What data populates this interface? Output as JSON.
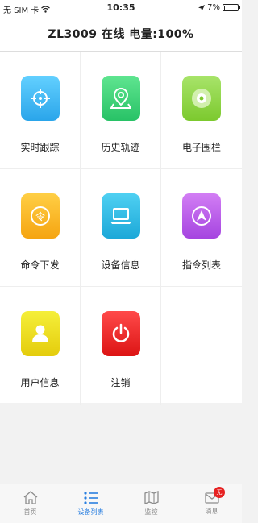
{
  "status_bar": {
    "carrier": "无 SIM 卡",
    "time": "10:35",
    "battery_percent": "7%",
    "battery_level": 0.07
  },
  "nav": {
    "title": "ZL3009   在线   电量:100%"
  },
  "menu": [
    {
      "label": "实时跟踪",
      "icon": "crosshair-icon",
      "color_top": "#63d0ff",
      "color_bottom": "#2aa5ea"
    },
    {
      "label": "历史轨迹",
      "icon": "map-pin-icon",
      "color_top": "#5fe590",
      "color_bottom": "#28c266"
    },
    {
      "label": "电子围栏",
      "icon": "fence-icon",
      "color_top": "#a8e46a",
      "color_bottom": "#7cc92e"
    },
    {
      "label": "命令下发",
      "icon": "command-icon",
      "color_top": "#ffcf45",
      "color_bottom": "#f5a411"
    },
    {
      "label": "设备信息",
      "icon": "laptop-icon",
      "color_top": "#4fd0f2",
      "color_bottom": "#1ca8d8"
    },
    {
      "label": "指令列表",
      "icon": "navigation-icon",
      "color_top": "#d27ef4",
      "color_bottom": "#a544e0"
    },
    {
      "label": "用户信息",
      "icon": "user-icon",
      "color_top": "#f5ef3a",
      "color_bottom": "#e4cc0c"
    },
    {
      "label": "注销",
      "icon": "power-icon",
      "color_top": "#ff4a4a",
      "color_bottom": "#dc1414"
    }
  ],
  "tabs": [
    {
      "label": "首页",
      "icon": "home-icon"
    },
    {
      "label": "设备列表",
      "icon": "list-icon"
    },
    {
      "label": "监控",
      "icon": "map-icon"
    },
    {
      "label": "消息",
      "icon": "mail-icon",
      "badge": "无"
    }
  ],
  "active_tab": "设备列表"
}
